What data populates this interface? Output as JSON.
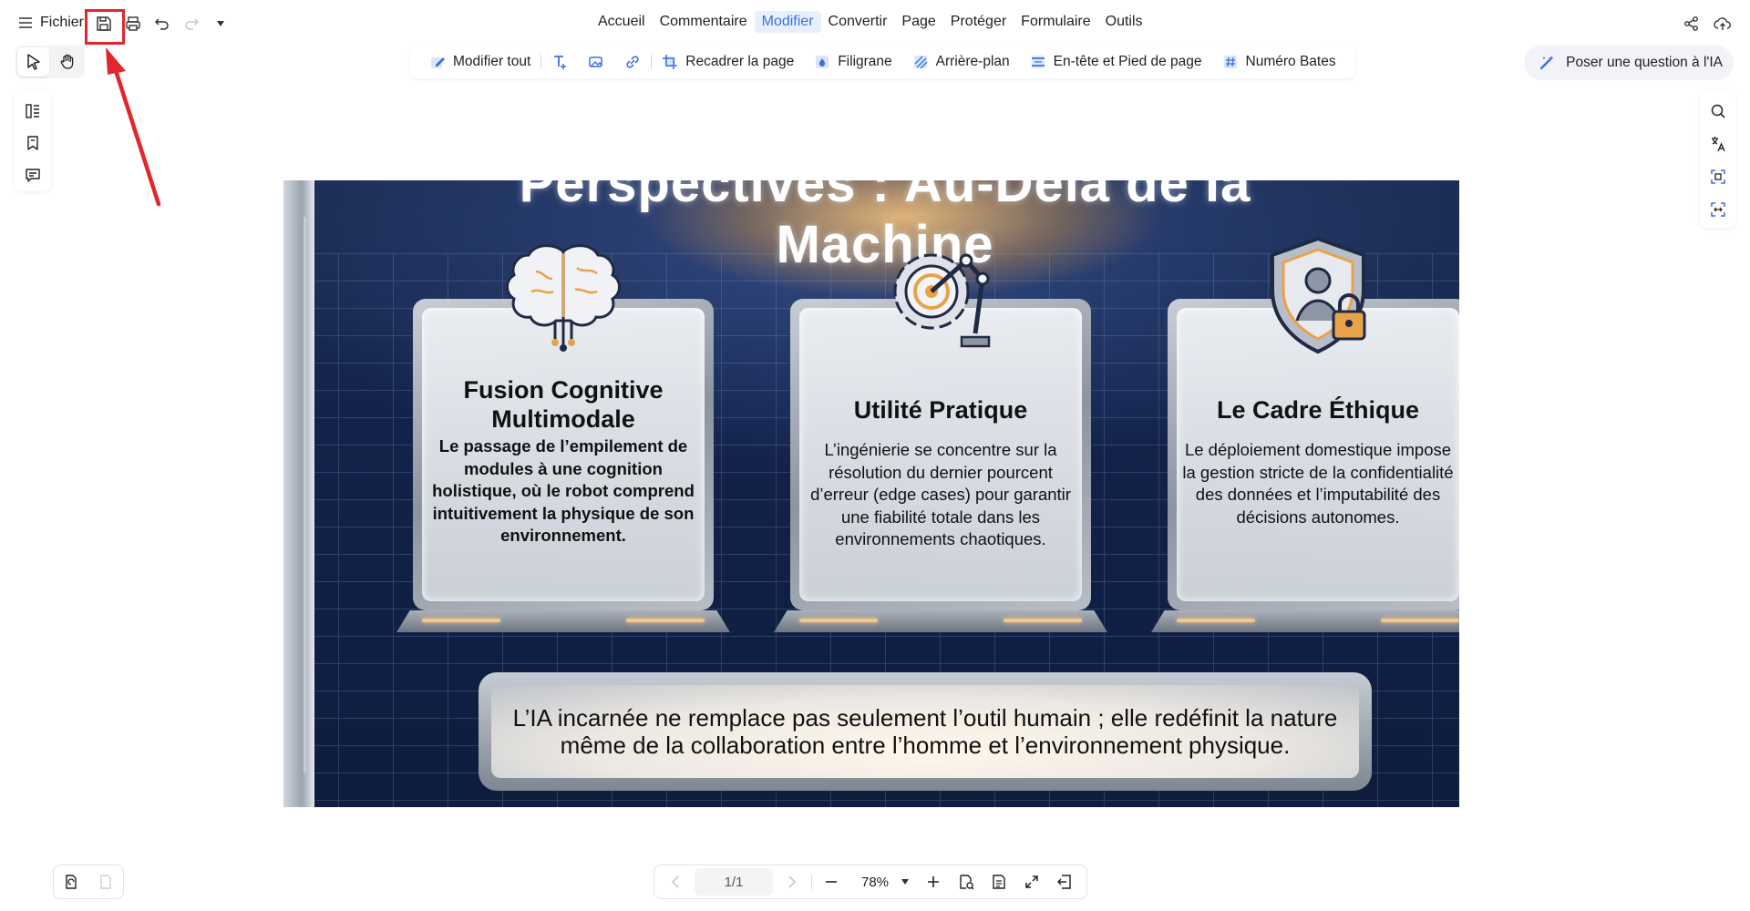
{
  "topbar": {
    "file_menu": "Fichier",
    "nav": [
      "Accueil",
      "Commentaire",
      "Modifier",
      "Convertir",
      "Page",
      "Protéger",
      "Formulaire",
      "Outils"
    ],
    "active_nav": "Modifier"
  },
  "toolbar": {
    "edit_all": "Modifier tout",
    "crop_page": "Recadrer la page",
    "watermark": "Filigrane",
    "background": "Arrière-plan",
    "header_footer": "En-tête et Pied de page",
    "bates": "Numéro Bates"
  },
  "ai": {
    "label": "Poser une question à l'IA"
  },
  "document": {
    "title": "Perspectives : Au-Delà de la Machine",
    "cards": [
      {
        "title": "Fusion Cognitive Multimodale",
        "text": "Le passage de l’empilement de modules à une cognition holistique, où le robot comprend intuitivement la physique de son environnement."
      },
      {
        "title": "Utilité Pratique",
        "text": "L’ingénierie se concentre sur la résolution du dernier pourcent d’erreur (edge cases) pour garantir une fiabilité totale dans les environnements chaotiques."
      },
      {
        "title": "Le Cadre Éthique",
        "text": "Le déploiement domestique impose la gestion stricte de la confidentialité des données et l’imputabilité des décisions autonomes."
      }
    ],
    "banner": "L’IA incarnée ne remplace pas seulement l’outil humain ; elle redéfinit la nature même de la collaboration entre l’homme et l’environnement physique."
  },
  "pager": {
    "page": "1/1",
    "zoom": "78%"
  },
  "colors": {
    "accent": "#3b6fe0",
    "highlight": "#e3262c"
  }
}
